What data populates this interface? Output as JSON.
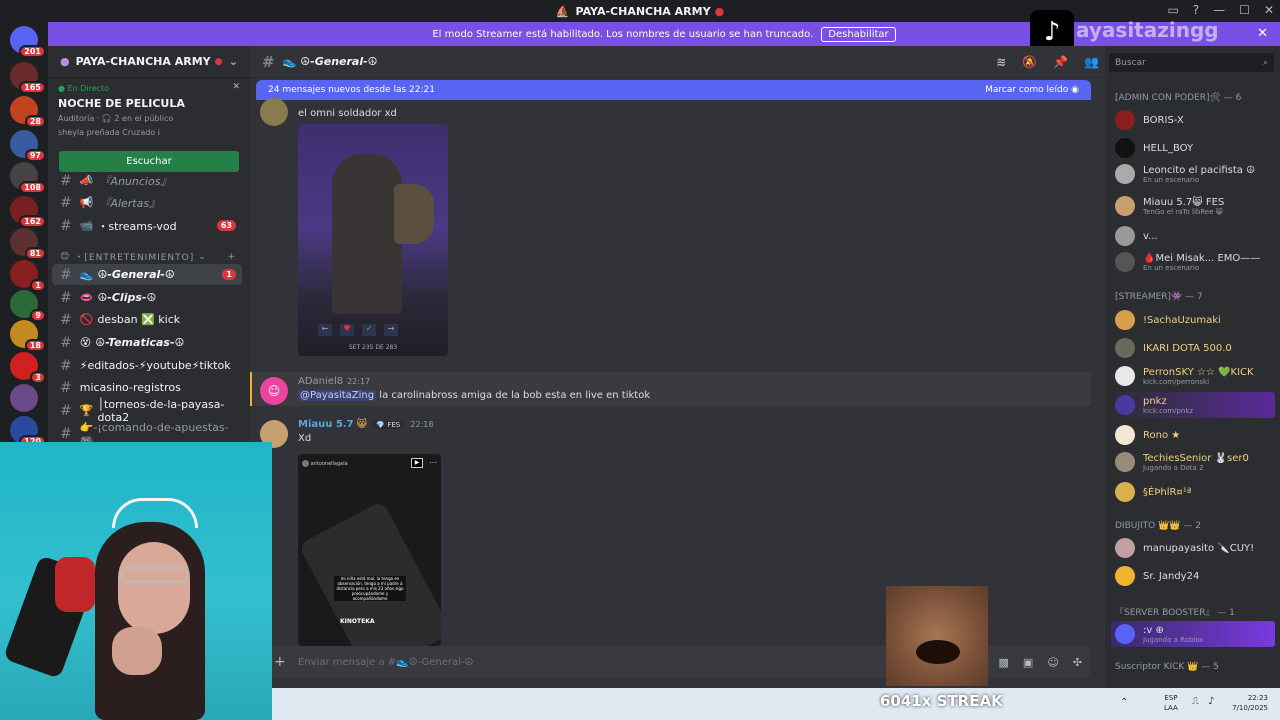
{
  "window": {
    "title": "PAYA-CHANCHA ARMY"
  },
  "banner": {
    "text": "El modo Streamer está habilitado. Los nombres de usuario se han truncado.",
    "button": "Deshabilitar"
  },
  "overlay": {
    "tiktok_handle": "ayasitazingg",
    "streak": "6041x STREAK"
  },
  "guilds": [
    {
      "badge": "201"
    },
    {
      "badge": "165"
    },
    {
      "badge": "28"
    },
    {
      "badge": "97"
    },
    {
      "badge": "108"
    },
    {
      "badge": "162"
    },
    {
      "badge": "81"
    },
    {
      "badge": "1"
    },
    {
      "badge": "9"
    },
    {
      "badge": "18"
    },
    {
      "badge": "3"
    },
    {
      "badge": "120"
    }
  ],
  "server": {
    "name": "PAYA-CHANCHA ARMY"
  },
  "live": {
    "status": "En Directo",
    "title": "NOCHE DE PELICULA",
    "meta": "Auditoría · 🎧 2 en el público",
    "user": "sheyla preñada Cruzado i",
    "button": "Escuchar"
  },
  "channels": [
    {
      "name": "『Anuncios』",
      "badge": ""
    },
    {
      "name": "『Alertas』",
      "badge": ""
    },
    {
      "name": "・streams-vod",
      "badge": "63"
    },
    {
      "name": "・[ENTRETENIMIENTO]",
      "badge": ""
    },
    {
      "name": "☮-General-☮",
      "badge": "1"
    },
    {
      "name": "☮-Clips-☮",
      "badge": ""
    },
    {
      "name": "desban ❎ kick",
      "badge": ""
    },
    {
      "name": "☮-Tematicas-☮",
      "badge": ""
    },
    {
      "name": "⚡editados-⚡youtube⚡tiktok",
      "badge": ""
    },
    {
      "name": "micasino-registros",
      "badge": ""
    },
    {
      "name": "│torneos-de-la-payasa-dota2",
      "badge": ""
    },
    {
      "name": "👉-¡comando-de-apuestas-🎮...",
      "badge": ""
    }
  ],
  "chat": {
    "channel": "☮-General-☮",
    "new_bar": "24 mensajes nuevos desde las 22:21",
    "mark_read": "Marcar como leído",
    "messages": [
      {
        "text": "el omni soldador xd",
        "image_caption": "SET 235 DE 283"
      },
      {
        "user": "ADaniel8",
        "time": "22:17",
        "mention": "@PayasitaZing",
        "text": "la carolinabross amiga de la bob esta en live en tiktok"
      },
      {
        "user": "Miauu 5.7",
        "tag": "FES",
        "time": "22:18",
        "text": "Xd",
        "embed_user": "antoonellagala",
        "embed_text": "mi niña está mal, la tengo en observación, tengo a mi padre a distancia pero a mis 23 años sigo preocupándome y acompañándome",
        "embed_label": "KINOTEKA"
      }
    ],
    "composer_placeholder": "Enviar mensaje a #👟☮-General-☮"
  },
  "members": {
    "search_placeholder": "Buscar",
    "groups": [
      {
        "title": "[ADMIN CON PODER]🛠 — 6",
        "items": [
          {
            "name": "BORIS-X",
            "sub": ""
          },
          {
            "name": "HELL_BOY",
            "sub": ""
          },
          {
            "name": "Leoncito el pacifista ☮",
            "sub": "En un escenario"
          },
          {
            "name": "Miauu 5.7😸 FES",
            "sub": "TenGo el raTo libRee 😸"
          },
          {
            "name": "v...",
            "sub": ""
          },
          {
            "name": "🩸Mei Misak... EMO——",
            "sub": "En un escenario"
          }
        ]
      },
      {
        "title": "[STREAMER]👾 — 7",
        "items": [
          {
            "name": "!SachaUzumaki",
            "sub": ""
          },
          {
            "name": "IKARI DOTA 500.0",
            "sub": ""
          },
          {
            "name": "PerronSKY ☆☆ 💚KICK",
            "sub": "kick.com/perronski"
          },
          {
            "name": "pnkz",
            "sub": "kick.com/pnkz"
          },
          {
            "name": "Rono ★",
            "sub": ""
          },
          {
            "name": "TechiesSenior 🐰ser0",
            "sub": "Jugando a Dota 2"
          },
          {
            "name": "§ÉÞhlR¤¹ª",
            "sub": ""
          }
        ]
      },
      {
        "title": "DIBUJITO 👑👑 — 2",
        "items": [
          {
            "name": "manupayasito 🔪CUY!",
            "sub": ""
          },
          {
            "name": "Sr. Jandy24",
            "sub": ""
          }
        ]
      },
      {
        "title": "『SERVER BOOSTER』 — 1",
        "items": [
          {
            "name": ":v ⊕",
            "sub": "Jugando a Roblox"
          }
        ]
      },
      {
        "title": "Suscriptor KICK 👑 — 5",
        "items": []
      }
    ]
  },
  "taskbar": {
    "lang": "ESP",
    "layout": "LAA",
    "time": "22:23",
    "date": "7/10/2025"
  },
  "colors": {
    "accent": "#5865f2",
    "streamer_banner": "#7a4fe6",
    "listen": "#248046",
    "badge": "#da373c"
  }
}
